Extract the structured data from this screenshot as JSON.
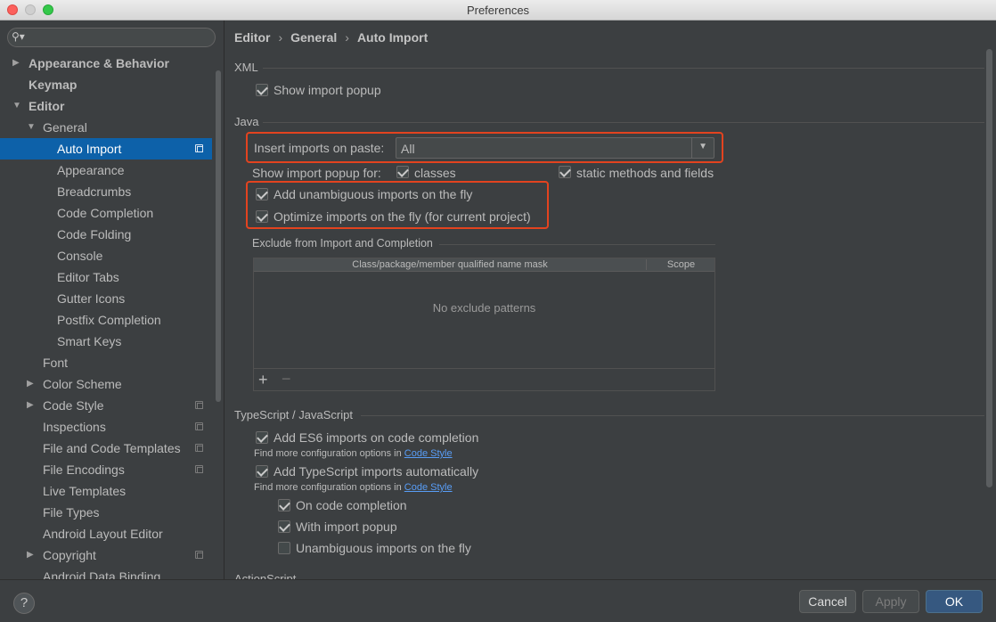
{
  "window": {
    "title": "Preferences"
  },
  "sidebar": {
    "search_placeholder": "",
    "items": [
      {
        "label": "Appearance & Behavior",
        "bold": true,
        "arrow": "right"
      },
      {
        "label": "Keymap",
        "bold": true
      },
      {
        "label": "Editor",
        "bold": true,
        "arrow": "down"
      },
      {
        "label": "General",
        "arrow": "down"
      },
      {
        "label": "Auto Import",
        "selected": true,
        "copy_icon": true
      },
      {
        "label": "Appearance"
      },
      {
        "label": "Breadcrumbs"
      },
      {
        "label": "Code Completion"
      },
      {
        "label": "Code Folding"
      },
      {
        "label": "Console"
      },
      {
        "label": "Editor Tabs"
      },
      {
        "label": "Gutter Icons"
      },
      {
        "label": "Postfix Completion"
      },
      {
        "label": "Smart Keys"
      },
      {
        "label": "Font"
      },
      {
        "label": "Color Scheme",
        "arrow": "right"
      },
      {
        "label": "Code Style",
        "arrow": "right",
        "copy_icon": true
      },
      {
        "label": "Inspections",
        "copy_icon": true
      },
      {
        "label": "File and Code Templates",
        "copy_icon": true
      },
      {
        "label": "File Encodings",
        "copy_icon": true
      },
      {
        "label": "Live Templates"
      },
      {
        "label": "File Types"
      },
      {
        "label": "Android Layout Editor"
      },
      {
        "label": "Copyright",
        "arrow": "right",
        "copy_icon": true
      },
      {
        "label": "Android Data Binding"
      }
    ]
  },
  "breadcrumb": [
    "Editor",
    "General",
    "Auto Import"
  ],
  "xml": {
    "title": "XML",
    "show_import_popup": {
      "label": "Show import popup",
      "checked": true
    }
  },
  "java": {
    "title": "Java",
    "insert_imports_label": "Insert imports on paste:",
    "insert_imports_value": "All",
    "show_popup_for_label": "Show import popup for:",
    "classes": {
      "label": "classes",
      "checked": true
    },
    "static_methods": {
      "label": "static methods and fields",
      "checked": true
    },
    "add_unambiguous": {
      "label": "Add unambiguous imports on the fly",
      "checked": true
    },
    "optimize_imports": {
      "label": "Optimize imports on the fly (for current project)",
      "checked": true
    },
    "exclude_title": "Exclude from Import and Completion",
    "table": {
      "columns": [
        "Class/package/member qualified name mask",
        "Scope"
      ],
      "empty_text": "No exclude patterns"
    }
  },
  "typescript": {
    "title": "TypeScript / JavaScript",
    "add_es6": {
      "label": "Add ES6 imports on code completion",
      "checked": true
    },
    "find_more_text": "Find more configuration options in",
    "code_style_link": "Code Style",
    "add_ts": {
      "label": "Add TypeScript imports automatically",
      "checked": true
    },
    "on_code_completion": {
      "label": "On code completion",
      "checked": true
    },
    "with_import_popup": {
      "label": "With import popup",
      "checked": true
    },
    "unambiguous_on_fly": {
      "label": "Unambiguous imports on the fly",
      "checked": false
    }
  },
  "actionscript": {
    "title": "ActionScript"
  },
  "buttons": {
    "help": "?",
    "cancel": "Cancel",
    "apply": "Apply",
    "ok": "OK"
  },
  "colors": {
    "selection": "#0d61a9",
    "highlight_box": "#e3431f",
    "link": "#589df6",
    "ok_button": "#365880"
  }
}
